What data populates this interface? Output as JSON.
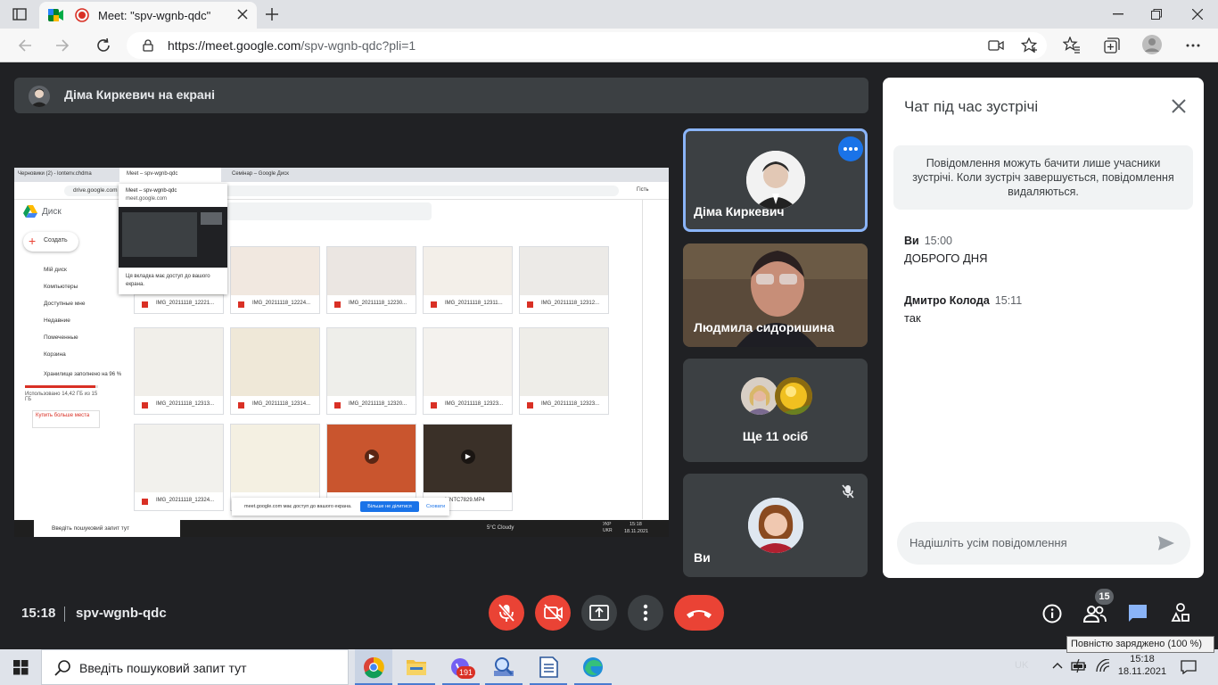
{
  "browser": {
    "tab_title": "Meet: \"spv-wgnb-qdc\"",
    "url_host": "https://meet.google.com",
    "url_path": "/spv-wgnb-qdc?pli=1"
  },
  "presentation": {
    "label": "Діма Киркевич на екрані",
    "shared_screen": {
      "tabs": [
        "Черновики (2) - lontenv.chdma",
        "Meet – spv-wgnb-qdc",
        "Семінар – Google Диск"
      ],
      "url": "drive.google.com",
      "profile": "Гість",
      "popup_title": "Meet – spv-wgnb-qdc",
      "popup_url": "meet.google.com",
      "popup_note": "Ця вкладка має доступ до вашого екрана.",
      "drive_title": "Диск",
      "create_label": "Создать",
      "nav": [
        "Мій диск",
        "Компьютеры",
        "Доступные мне",
        "Недавние",
        "Помеченные",
        "Корзина"
      ],
      "storage_label": "Хранилище заполнено на 96 %",
      "storage_used": "Использовано 14,42 ГБ из 15 ГБ",
      "buy_more": "Купить больше места",
      "files_row1": [
        "IMG_20211118_12221...",
        "IMG_20211118_12224...",
        "IMG_20211118_12230...",
        "IMG_20211118_12311...",
        "IMG_20211118_12312..."
      ],
      "files_row2": [
        "IMG_20211118_12313...",
        "IMG_20211118_12314...",
        "IMG_20211118_12320...",
        "IMG_20211118_12323...",
        "IMG_20211118_12323..."
      ],
      "files_row3": [
        "IMG_20211118_12324...",
        "",
        "",
        "MNTC7829.MP4"
      ],
      "share_bar_text": "meet.google.com має доступ до вашого екрана.",
      "stop_sharing": "Більше не ділитися",
      "hide": "Сховати",
      "taskbar_search": "Введіть пошуковий запит тут",
      "weather": "5°C Cloudy",
      "lang": "УКР UKR",
      "time": "15:18",
      "date": "18.11.2021"
    }
  },
  "participants": [
    {
      "name": "Діма Киркевич"
    },
    {
      "name": "Людмила сидоришина"
    },
    {
      "name": "Ще 11 осіб"
    },
    {
      "name": "Ви"
    }
  ],
  "chat": {
    "title": "Чат під час зустрічі",
    "note": "Повідомлення можуть бачити лише учасники зустрічі. Коли зустріч завершується, повідомлення видаляються.",
    "messages": [
      {
        "sender": "Ви",
        "time": "15:00",
        "text": "ДОБРОГО ДНЯ"
      },
      {
        "sender": "Дмитро Колода",
        "time": "15:11",
        "text": "так"
      }
    ],
    "input_placeholder": "Надішліть усім повідомлення"
  },
  "bottom": {
    "time": "15:18",
    "meeting_code": "spv-wgnb-qdc",
    "people_count": "15"
  },
  "taskbar": {
    "search_placeholder": "Введіть пошуковий запит тут",
    "viber_badge": "191",
    "lang": "UK",
    "time": "15:18",
    "date": "18.11.2021",
    "tooltip": "Повністю заряджено (100 %)"
  },
  "colors": {
    "meet_bg": "#202124",
    "tile_bg": "#3c4043",
    "hangup_red": "#ea4335",
    "accent_blue": "#1a73e8",
    "chat_icon_blue": "#8ab4f8"
  }
}
